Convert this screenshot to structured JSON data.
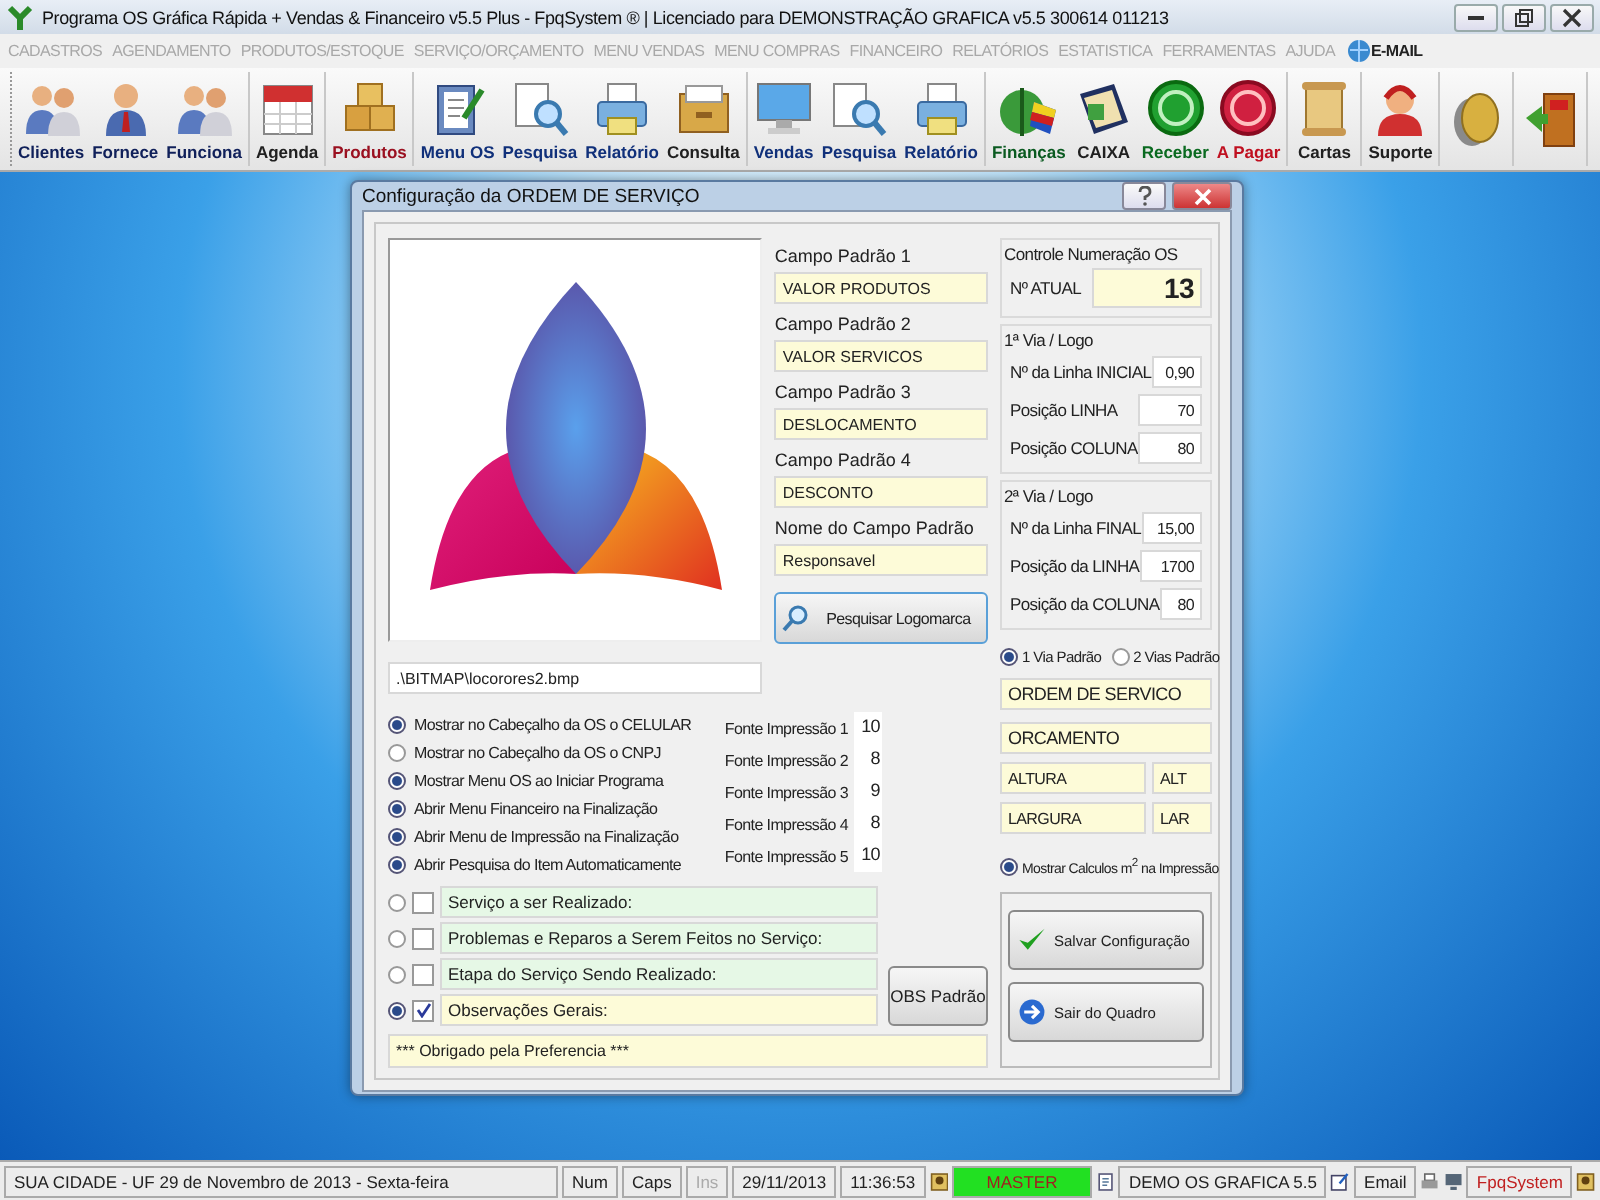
{
  "window": {
    "title": "Programa OS Gráfica Rápida + Vendas & Financeiro v5.5 Plus - FpqSystem ® | Licenciado para  DEMONSTRAÇÃO GRAFICA v5.5 300614 011213"
  },
  "menu": [
    {
      "label": "CADASTROS",
      "disabled": true
    },
    {
      "label": "AGENDAMENTO",
      "disabled": true
    },
    {
      "label": "PRODUTOS/ESTOQUE",
      "disabled": true
    },
    {
      "label": "SERVIÇO/ORÇAMENTO",
      "disabled": true
    },
    {
      "label": "MENU VENDAS",
      "disabled": true
    },
    {
      "label": "MENU COMPRAS",
      "disabled": true
    },
    {
      "label": "FINANCEIRO",
      "disabled": true
    },
    {
      "label": "RELATÓRIOS",
      "disabled": true
    },
    {
      "label": "ESTATISTICA",
      "disabled": true
    },
    {
      "label": "FERRAMENTAS",
      "disabled": true
    },
    {
      "label": "AJUDA",
      "disabled": true
    },
    {
      "label": "E-MAIL",
      "disabled": false
    }
  ],
  "toolbar": {
    "groups": [
      [
        {
          "label": "Clientes",
          "color": "#10205a"
        },
        {
          "label": "Fornece",
          "color": "#10205a"
        },
        {
          "label": "Funciona",
          "color": "#10205a"
        }
      ],
      [
        {
          "label": "Agenda",
          "color": "#202020"
        }
      ],
      [
        {
          "label": "Produtos",
          "color": "#9a1020"
        }
      ],
      [
        {
          "label": "Menu OS",
          "color": "#10307a"
        },
        {
          "label": "Pesquisa",
          "color": "#10307a"
        },
        {
          "label": "Relatório",
          "color": "#10307a"
        },
        {
          "label": "Consulta",
          "color": "#202020"
        }
      ],
      [
        {
          "label": "Vendas",
          "color": "#10307a"
        },
        {
          "label": "Pesquisa",
          "color": "#10307a"
        },
        {
          "label": "Relatório",
          "color": "#10307a"
        }
      ],
      [
        {
          "label": "Finanças",
          "color": "#0a5a20"
        },
        {
          "label": "CAIXA",
          "color": "#202020"
        },
        {
          "label": "Receber",
          "color": "#0a6a20"
        },
        {
          "label": "A Pagar",
          "color": "#c01020"
        }
      ],
      [
        {
          "label": "Cartas",
          "color": "#202020"
        }
      ],
      [
        {
          "label": "Suporte",
          "color": "#202020"
        }
      ]
    ]
  },
  "dialog": {
    "title": "Configuração da ORDEM DE SERVIÇO",
    "logo_path": ".\\BITMAP\\locorores2.bmp",
    "fields": [
      {
        "label": "Campo Padrão 1",
        "value": "VALOR PRODUTOS"
      },
      {
        "label": "Campo Padrão 2",
        "value": "VALOR SERVICOS"
      },
      {
        "label": "Campo Padrão 3",
        "value": "DESLOCAMENTO"
      },
      {
        "label": "Campo Padrão 4",
        "value": "DESCONTO"
      },
      {
        "label": "Nome do Campo Padrão",
        "value": "Responsavel"
      }
    ],
    "search_logo_button": "Pesquisar Logomarca",
    "options": [
      {
        "label": "Mostrar no Cabeçalho da OS o CELULAR",
        "selected": true
      },
      {
        "label": "Mostrar no Cabeçalho da OS o CNPJ",
        "selected": false
      },
      {
        "label": "Mostrar Menu OS ao Iniciar Programa",
        "selected": true
      },
      {
        "label": "Abrir Menu Financeiro na Finalização",
        "selected": true
      },
      {
        "label": "Abrir Menu de Impressão na Finalização",
        "selected": true
      },
      {
        "label": "Abrir Pesquisa do Item Automaticamente",
        "selected": true
      }
    ],
    "fonts": [
      {
        "label": "Fonte Impressão 1",
        "value": "10"
      },
      {
        "label": "Fonte Impressão 2",
        "value": "8"
      },
      {
        "label": "Fonte Impressão 3",
        "value": "9"
      },
      {
        "label": "Fonte Impressão 4",
        "value": "8"
      },
      {
        "label": "Fonte Impressão 5",
        "value": "10"
      }
    ],
    "sections": [
      {
        "text": "Serviço a ser Realizado:",
        "selected": false,
        "checked": false
      },
      {
        "text": "Problemas e Reparos a Serem Feitos no Serviço:",
        "selected": false,
        "checked": false
      },
      {
        "text": "Etapa do Serviço Sendo Realizado:",
        "selected": false,
        "checked": false
      },
      {
        "text": "Observações Gerais:",
        "selected": true,
        "checked": true
      }
    ],
    "obs_button": "OBS Padrão",
    "footer_text": "*** Obrigado pela Preferencia ***",
    "numbering": {
      "title": "Controle Numeração OS",
      "label": "Nº ATUAL",
      "value": "13"
    },
    "via_groups": [
      {
        "title": "1ª Via / Logo",
        "rows": [
          {
            "label": "Nº da Linha INICIAL",
            "value": "0,90"
          },
          {
            "label": "Posição LINHA",
            "value": "70"
          },
          {
            "label": "Posição COLUNA",
            "value": "80"
          }
        ]
      },
      {
        "title": "2ª Via / Logo",
        "rows": [
          {
            "label": "Nº da Linha FINAL",
            "value": "15,00"
          },
          {
            "label": "Posição da LINHA",
            "value": "1700"
          },
          {
            "label": "Posição da COLUNA",
            "value": "80"
          }
        ]
      }
    ],
    "via_options": [
      {
        "label": "1 Via Padrão",
        "selected": true
      },
      {
        "label": "2 Vias Padrão",
        "selected": false
      }
    ],
    "doc_titles": [
      "ORDEM DE SERVICO",
      "ORCAMENTO"
    ],
    "measures": [
      {
        "name": "ALTURA",
        "abbr": "ALT"
      },
      {
        "name": "LARGURA",
        "abbr": "LAR"
      }
    ],
    "show_calc": {
      "label": "Mostrar Calculos m$^{2}$ na Impressão",
      "selected": true
    },
    "save_button": "Salvar Configuração",
    "exit_button": "Sair do Quadro"
  },
  "status_bar": {
    "location": "SUA CIDADE - UF 29 de Novembro de 2013 - Sexta-feira",
    "keys": [
      {
        "label": "Num",
        "disabled": false
      },
      {
        "label": "Caps",
        "disabled": false
      },
      {
        "label": "Ins",
        "disabled": true
      }
    ],
    "date": "29/11/2013",
    "time": "11:36:53",
    "user": "MASTER",
    "company": "DEMO OS GRAFICA 5.5",
    "email": "Email",
    "brand": "FpqSystem"
  }
}
